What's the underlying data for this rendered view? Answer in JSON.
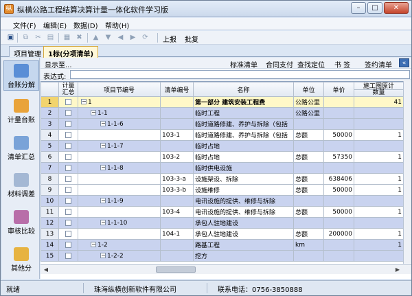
{
  "window": {
    "title": "纵横公路工程结算决算计量一体化软件学习版",
    "controls": [
      "minimize-icon",
      "maximize-icon",
      "close-icon"
    ]
  },
  "menu": [
    "文件(F)",
    "编辑(E)",
    "数据(D)",
    "帮助(H)"
  ],
  "toolbar": {
    "report_label": "上报",
    "approve_label": "批复"
  },
  "tabs": [
    "项目管理",
    "1标(分项清单)"
  ],
  "leftnav": [
    {
      "label": "台账分解",
      "icon": "ledger-split-icon",
      "color": "#5a8ed6"
    },
    {
      "label": "计量台账",
      "icon": "measure-ledger-icon",
      "color": "#e9a33a"
    },
    {
      "label": "清单汇总",
      "icon": "list-summary-icon",
      "color": "#7aa3d8"
    },
    {
      "label": "材料调差",
      "icon": "material-adjust-icon",
      "color": "#a4b8d4"
    },
    {
      "label": "审核比较",
      "icon": "audit-compare-icon",
      "color": "#b86ea9"
    },
    {
      "label": "其他分",
      "icon": "other-icon",
      "color": "#e7b341"
    }
  ],
  "subbar": {
    "show_to": "显示至...",
    "buttons": [
      "标准清单",
      "合同支付",
      "查找定位",
      "书 签",
      "签约清单"
    ],
    "collapse_icon": "«"
  },
  "expression": {
    "label": "表达式:",
    "value": ""
  },
  "grid": {
    "columns": [
      "计量汇总",
      "项目节编号",
      "清单编号",
      "名称",
      "单位",
      "单价",
      "施工图原计",
      "数量"
    ],
    "rows": [
      {
        "n": "1",
        "tree": "1",
        "level": 0,
        "code": "",
        "name": "第一部分 建筑安装工程费",
        "unit": "公路公里",
        "price": "",
        "qty": "41",
        "state": "sel"
      },
      {
        "n": "2",
        "tree": "1-1",
        "level": 1,
        "code": "",
        "name": "临时工程",
        "unit": "公路公里",
        "price": "",
        "qty": "",
        "state": "hl"
      },
      {
        "n": "3",
        "tree": "1-1-6",
        "level": 2,
        "code": "",
        "name": "临时道路修建、养护与拆除（包括",
        "unit": "",
        "price": "",
        "qty": "",
        "state": "hl"
      },
      {
        "n": "4",
        "tree": "",
        "level": 3,
        "code": "103-1",
        "name": "临时道路修建、养护与拆除（包括",
        "unit": "总额",
        "price": "50000",
        "qty": "1",
        "state": ""
      },
      {
        "n": "5",
        "tree": "1-1-7",
        "level": 2,
        "code": "",
        "name": "临时占地",
        "unit": "",
        "price": "",
        "qty": "",
        "state": "hl"
      },
      {
        "n": "6",
        "tree": "",
        "level": 3,
        "code": "103-2",
        "name": "临时占地",
        "unit": "总额",
        "price": "57350",
        "qty": "1",
        "state": ""
      },
      {
        "n": "7",
        "tree": "1-1-8",
        "level": 2,
        "code": "",
        "name": "临时供电设施",
        "unit": "",
        "price": "",
        "qty": "",
        "state": "hl"
      },
      {
        "n": "8",
        "tree": "",
        "level": 3,
        "code": "103-3-a",
        "name": "设施架设、拆除",
        "unit": "总额",
        "price": "638406",
        "qty": "1",
        "state": ""
      },
      {
        "n": "9",
        "tree": "",
        "level": 3,
        "code": "103-3-b",
        "name": "设施维修",
        "unit": "总额",
        "price": "50000",
        "qty": "1",
        "state": ""
      },
      {
        "n": "10",
        "tree": "1-1-9",
        "level": 2,
        "code": "",
        "name": "电讯设施的提供、维修与拆除",
        "unit": "",
        "price": "",
        "qty": "",
        "state": "hl"
      },
      {
        "n": "11",
        "tree": "",
        "level": 3,
        "code": "103-4",
        "name": "电讯设施的提供、维修与拆除",
        "unit": "总额",
        "price": "50000",
        "qty": "1",
        "state": ""
      },
      {
        "n": "12",
        "tree": "1-1-10",
        "level": 2,
        "code": "",
        "name": "承包人驻地建设",
        "unit": "",
        "price": "",
        "qty": "",
        "state": "hl"
      },
      {
        "n": "13",
        "tree": "",
        "level": 3,
        "code": "104-1",
        "name": "承包人驻地建设",
        "unit": "总额",
        "price": "200000",
        "qty": "1",
        "state": ""
      },
      {
        "n": "14",
        "tree": "1-2",
        "level": 1,
        "code": "",
        "name": "路基工程",
        "unit": "km",
        "price": "",
        "qty": "1",
        "state": "hl"
      },
      {
        "n": "15",
        "tree": "1-2-2",
        "level": 2,
        "code": "",
        "name": "挖方",
        "unit": "",
        "price": "",
        "qty": "",
        "state": "hl"
      }
    ]
  },
  "status": {
    "ready": "就绪",
    "company": "珠海纵横创新软件有限公司",
    "phone": "联系电话：0756-3850888"
  }
}
